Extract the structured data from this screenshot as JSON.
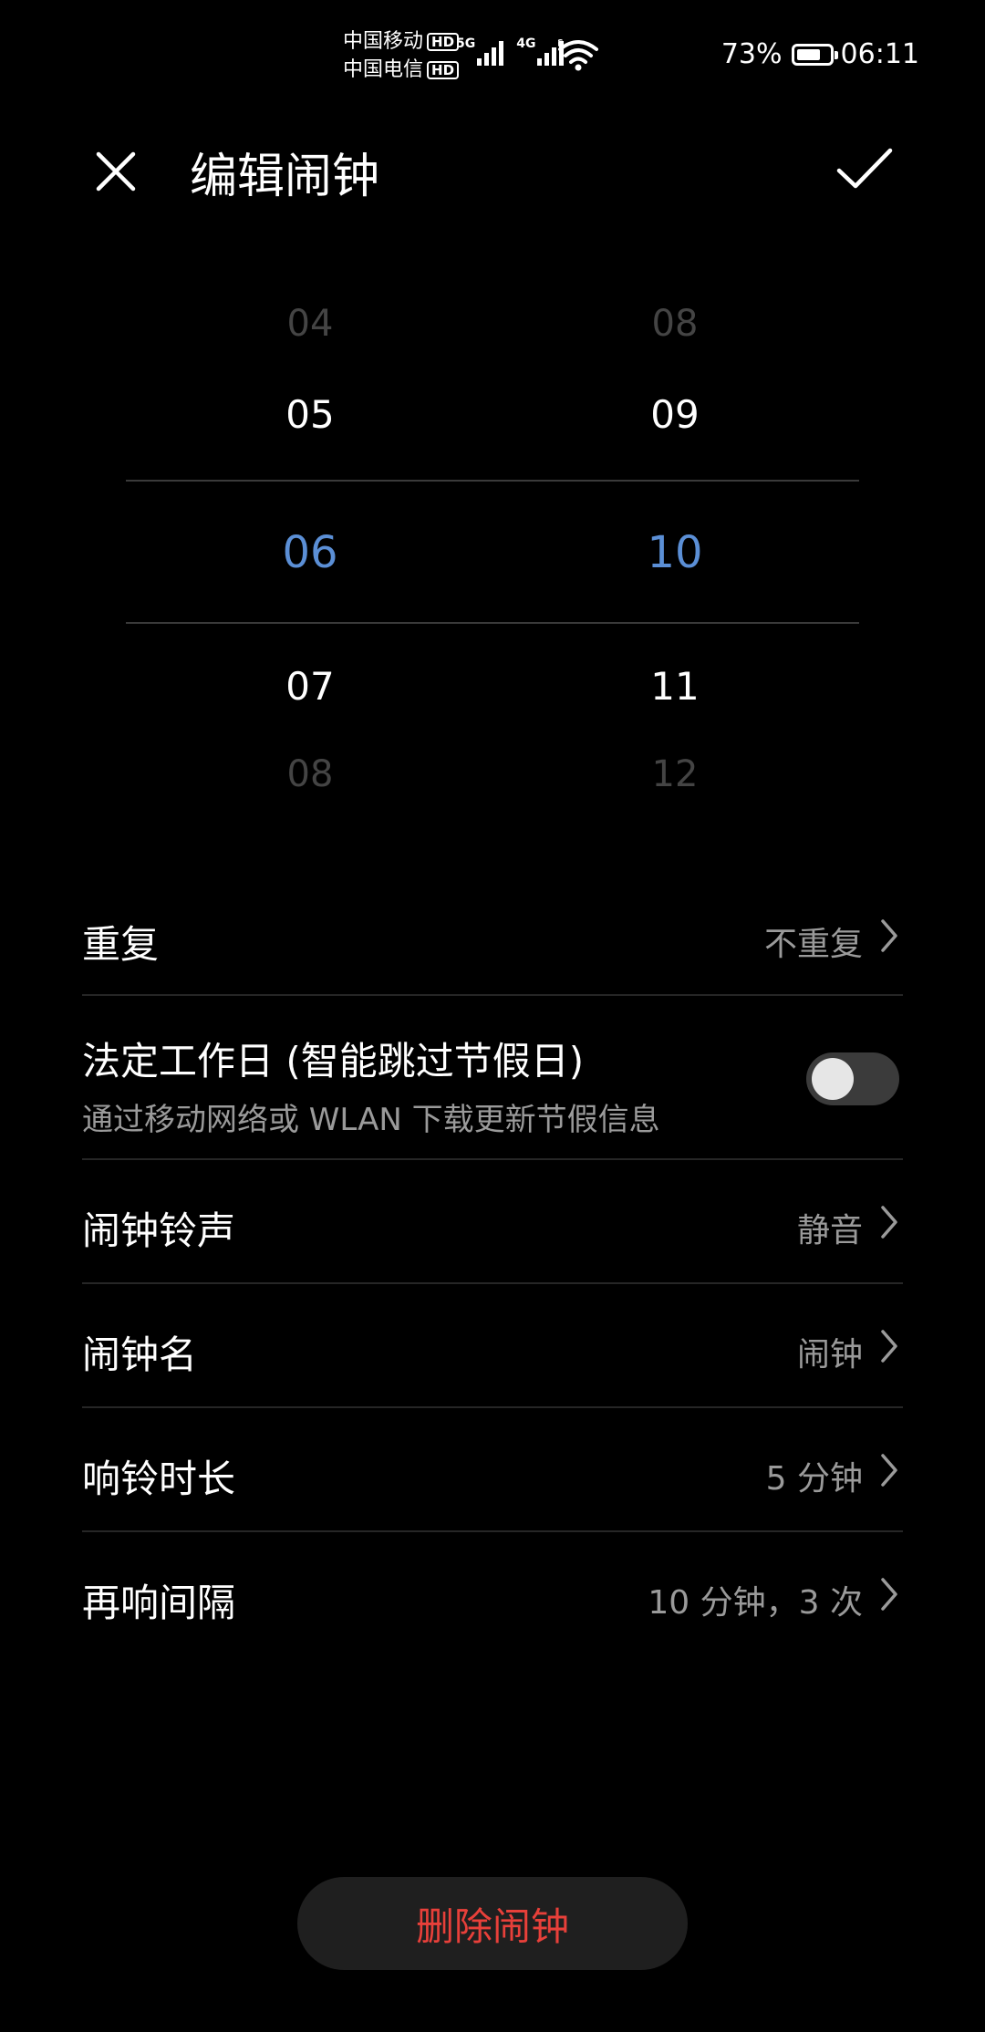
{
  "status_bar": {
    "carrier1": "中国移动",
    "carrier2": "中国电信",
    "hd": "HD",
    "net1": "5G",
    "net2": "4G",
    "wifi_badge": "6",
    "battery_percent": "73%",
    "battery_level": 0.73,
    "time": "06:11"
  },
  "header": {
    "title": "编辑闹钟",
    "close_icon": "close-icon",
    "confirm_icon": "check-icon"
  },
  "picker": {
    "hours": [
      "04",
      "05",
      "06",
      "07",
      "08"
    ],
    "minutes": [
      "08",
      "09",
      "10",
      "11",
      "12"
    ],
    "selected_hour": "06",
    "selected_minute": "10"
  },
  "settings": {
    "repeat": {
      "label": "重复",
      "value": "不重复"
    },
    "workday": {
      "label": "法定工作日 (智能跳过节假日)",
      "sub": "通过移动网络或 WLAN 下载更新节假信息",
      "enabled": false
    },
    "ringtone": {
      "label": "闹钟铃声",
      "value": "静音"
    },
    "name": {
      "label": "闹钟名",
      "value": "闹钟"
    },
    "duration": {
      "label": "响铃时长",
      "value": "5 分钟"
    },
    "snooze": {
      "label": "再响间隔",
      "value": "10 分钟，3 次"
    }
  },
  "delete_button": "删除闹钟",
  "colors": {
    "accent": "#5b8fd6",
    "danger": "#e8403a",
    "background": "#000000"
  }
}
